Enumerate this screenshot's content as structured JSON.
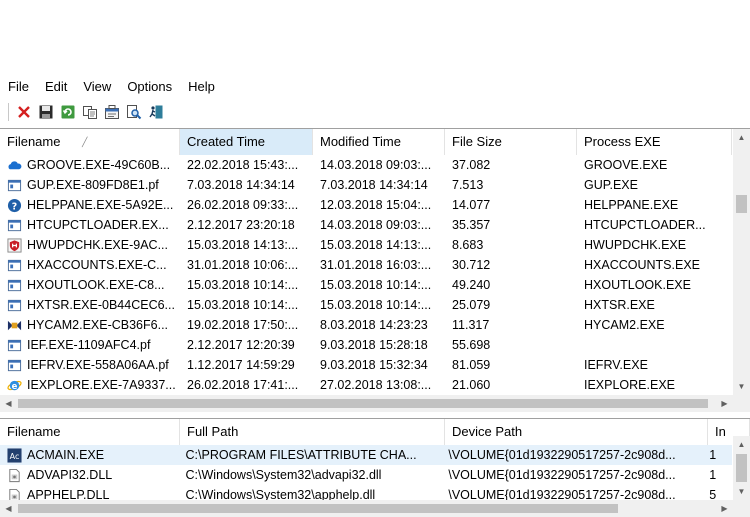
{
  "menu": [
    "File",
    "Edit",
    "View",
    "Options",
    "Help"
  ],
  "toolbar": [
    {
      "name": "delete-icon",
      "glyph": "✕"
    },
    {
      "name": "save-icon",
      "glyph": ""
    },
    {
      "name": "refresh-icon",
      "glyph": ""
    },
    {
      "name": "copy-icon",
      "glyph": ""
    },
    {
      "name": "properties-icon",
      "glyph": ""
    },
    {
      "name": "find-icon",
      "glyph": ""
    },
    {
      "name": "exit-icon",
      "glyph": ""
    }
  ],
  "top_table": {
    "columns": [
      "Filename",
      "Created Time",
      "Modified Time",
      "File Size",
      "Process EXE"
    ],
    "rows": [
      {
        "icon": "onedrive",
        "filename": "GROOVE.EXE-49C60B...",
        "created": "22.02.2018 15:43:...",
        "modified": "14.03.2018 09:03:...",
        "size": "37.082",
        "process": "GROOVE.EXE"
      },
      {
        "icon": "window",
        "filename": "GUP.EXE-809FD8E1.pf",
        "created": "7.03.2018 14:34:14",
        "modified": "7.03.2018 14:34:14",
        "size": "7.513",
        "process": "GUP.EXE"
      },
      {
        "icon": "help",
        "filename": "HELPPANE.EXE-5A92E...",
        "created": "26.02.2018 09:33:...",
        "modified": "12.03.2018 15:04:...",
        "size": "14.077",
        "process": "HELPPANE.EXE"
      },
      {
        "icon": "window",
        "filename": "HTCUPCTLOADER.EX...",
        "created": "2.12.2017 23:20:18",
        "modified": "14.03.2018 09:03:...",
        "size": "35.357",
        "process": "HTCUPCTLOADER..."
      },
      {
        "icon": "shield",
        "filename": "HWUPDCHK.EXE-9AC...",
        "created": "15.03.2018 14:13:...",
        "modified": "15.03.2018 14:13:...",
        "size": "8.683",
        "process": "HWUPDCHK.EXE"
      },
      {
        "icon": "window",
        "filename": "HXACCOUNTS.EXE-C...",
        "created": "31.01.2018 10:06:...",
        "modified": "31.01.2018 16:03:...",
        "size": "30.712",
        "process": "HXACCOUNTS.EXE"
      },
      {
        "icon": "window",
        "filename": "HXOUTLOOK.EXE-C8...",
        "created": "15.03.2018 10:14:...",
        "modified": "15.03.2018 10:14:...",
        "size": "49.240",
        "process": "HXOUTLOOK.EXE"
      },
      {
        "icon": "window",
        "filename": "HXTSR.EXE-0B44CEC6...",
        "created": "15.03.2018 10:14:...",
        "modified": "15.03.2018 10:14:...",
        "size": "25.079",
        "process": "HXTSR.EXE"
      },
      {
        "icon": "cam",
        "filename": "HYCAM2.EXE-CB36F6...",
        "created": "19.02.2018 17:50:...",
        "modified": "8.03.2018 14:23:23",
        "size": "11.317",
        "process": "HYCAM2.EXE"
      },
      {
        "icon": "window",
        "filename": "IEF.EXE-1109AFC4.pf",
        "created": "2.12.2017 12:20:39",
        "modified": "9.03.2018 15:28:18",
        "size": "55.698",
        "process": ""
      },
      {
        "icon": "window",
        "filename": "IEFRV.EXE-558A06AA.pf",
        "created": "1.12.2017 14:59:29",
        "modified": "9.03.2018 15:32:34",
        "size": "81.059",
        "process": "IEFRV.EXE"
      },
      {
        "icon": "ie",
        "filename": "IEXPLORE.EXE-7A9337...",
        "created": "26.02.2018 17:41:...",
        "modified": "27.02.2018 13:08:...",
        "size": "21.060",
        "process": "IEXPLORE.EXE"
      }
    ]
  },
  "bottom_table": {
    "columns": [
      "Filename",
      "Full Path",
      "Device Path",
      "In"
    ],
    "rows": [
      {
        "icon": "ac",
        "filename": "ACMAIN.EXE",
        "full_path": "C:\\PROGRAM FILES\\ATTRIBUTE CHA...",
        "device_path": "\\VOLUME{01d1932290517257-2c908d...",
        "index": "1"
      },
      {
        "icon": "doc",
        "filename": "ADVAPI32.DLL",
        "full_path": "C:\\Windows\\System32\\advapi32.dll",
        "device_path": "\\VOLUME{01d1932290517257-2c908d...",
        "index": "1"
      },
      {
        "icon": "doc",
        "filename": "APPHELP.DLL",
        "full_path": "C:\\Windows\\System32\\apphelp.dll",
        "device_path": "\\VOLUME{01d1932290517257-2c908d...",
        "index": "5"
      }
    ]
  }
}
